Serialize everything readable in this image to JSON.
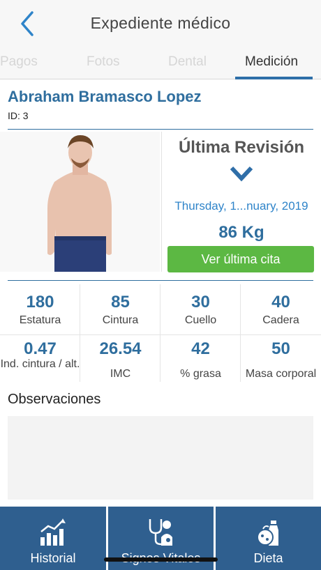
{
  "header": {
    "title": "Expediente médico"
  },
  "tabs": [
    {
      "label": "Pagos"
    },
    {
      "label": "Fotos"
    },
    {
      "label": "Dental"
    },
    {
      "label": "Medición"
    }
  ],
  "patient": {
    "name": "Abraham Bramasco Lopez",
    "id_label": "ID: 3"
  },
  "review": {
    "title": "Última Revisión",
    "date": "Thursday, 1...nuary, 2019",
    "weight": "86 Kg",
    "button_label": "Ver última cita"
  },
  "metrics": [
    {
      "value": "180",
      "label": "Estatura"
    },
    {
      "value": "85",
      "label": "Cintura"
    },
    {
      "value": "30",
      "label": "Cuello"
    },
    {
      "value": "40",
      "label": "Cadera"
    },
    {
      "value": "0.47",
      "label": "Ind. cintura / alt."
    },
    {
      "value": "26.54",
      "label": "IMC"
    },
    {
      "value": "42",
      "label": "% grasa"
    },
    {
      "value": "50",
      "label": "Masa corporal"
    }
  ],
  "observations": {
    "title": "Observaciones",
    "text": ""
  },
  "bottom_nav": [
    {
      "label": "Historial",
      "icon": "chart-icon"
    },
    {
      "label": "Signos Vitales",
      "icon": "stethoscope-icon"
    },
    {
      "label": "Dieta",
      "icon": "food-icon"
    }
  ],
  "colors": {
    "accent": "#2f6e9e",
    "link": "#2f84c9",
    "button_green": "#5cb843",
    "nav_bg": "#2f5f8f"
  }
}
